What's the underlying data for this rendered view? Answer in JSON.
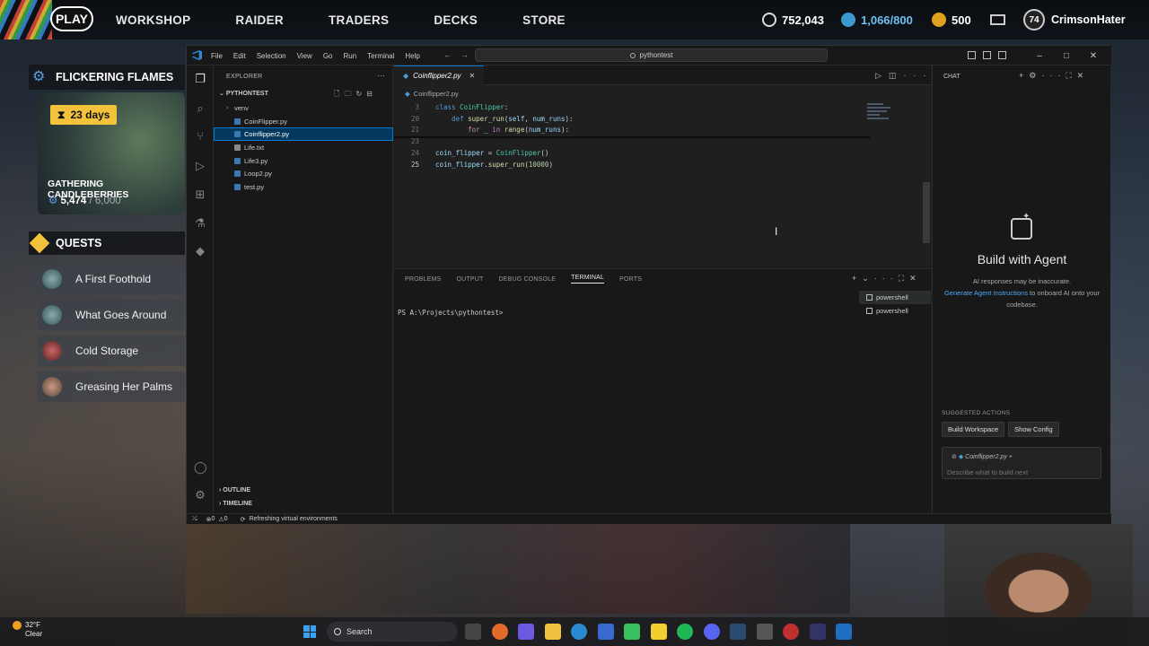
{
  "game": {
    "play_label": "PLAY",
    "nav": [
      "WORKSHOP",
      "RAIDER",
      "TRADERS",
      "DECKS",
      "STORE"
    ],
    "coins": "752,043",
    "tokens": "1,066/800",
    "creds": "500",
    "level": "74",
    "username": "CrimsonHater",
    "event": {
      "title": "FLICKERING FLAMES",
      "days": "23 days",
      "card_title": "GATHERING CANDLEBERRIES",
      "progress": "5,474",
      "max": "6,000"
    },
    "quests_title": "QUESTS",
    "quests": [
      "A First Foothold",
      "What Goes Around",
      "Cold Storage",
      "Greasing Her Palms"
    ]
  },
  "vscode": {
    "menu": [
      "File",
      "Edit",
      "Selection",
      "View",
      "Go",
      "Run",
      "Terminal",
      "Help"
    ],
    "search": "pythontest",
    "explorer_label": "EXPLORER",
    "root": "PYTHONTEST",
    "files": [
      {
        "name": "venv",
        "folder": true
      },
      {
        "name": "CoinFlipper.py"
      },
      {
        "name": "Coinflipper2.py",
        "selected": true
      },
      {
        "name": "Life.txt"
      },
      {
        "name": "Life3.py"
      },
      {
        "name": "Loop2.py"
      },
      {
        "name": "test.py"
      }
    ],
    "outline_label": "OUTLINE",
    "timeline_label": "TIMELINE",
    "tab": "Coinflipper2.py",
    "breadcrumb": "Coinflipper2.py",
    "code": [
      {
        "ln": "3",
        "text": "class CoinFlipper:"
      },
      {
        "ln": "20",
        "text": "    def super_run(self, num_runs):"
      },
      {
        "ln": "21",
        "text": "        for _ in range(num_runs):"
      },
      {
        "ln": "23",
        "text": ""
      },
      {
        "ln": "24",
        "text": "coin_flipper = CoinFlipper()"
      },
      {
        "ln": "25",
        "text": "coin_flipper.super_run(10000)"
      }
    ],
    "panel_tabs": [
      "PROBLEMS",
      "OUTPUT",
      "DEBUG CONSOLE",
      "TERMINAL",
      "PORTS"
    ],
    "terminal_prompt": "PS A:\\Projects\\pythontest>",
    "terminals": [
      "powershell",
      "powershell"
    ],
    "chat": {
      "header": "CHAT",
      "title": "Build with Agent",
      "disclaimer": "AI responses may be inaccurate.",
      "link": "Generate Agent Instructions",
      "link_suffix": "to onboard AI onto your codebase.",
      "suggested_label": "SUGGESTED ACTIONS",
      "actions": [
        "Build Workspace",
        "Show Config"
      ],
      "context_file": "Coinflipper2.py",
      "input_placeholder": "Describe what to build next"
    },
    "status": {
      "errors": "0",
      "warnings": "0",
      "message": "Refreshing virtual environments"
    }
  },
  "taskbar": {
    "temperature": "32°F",
    "condition": "Clear",
    "search_label": "Search"
  },
  "colors": {
    "accent": "#0078d4",
    "selection": "#04395e",
    "quest_gold": "#f2c23a",
    "link": "#4daafc"
  }
}
